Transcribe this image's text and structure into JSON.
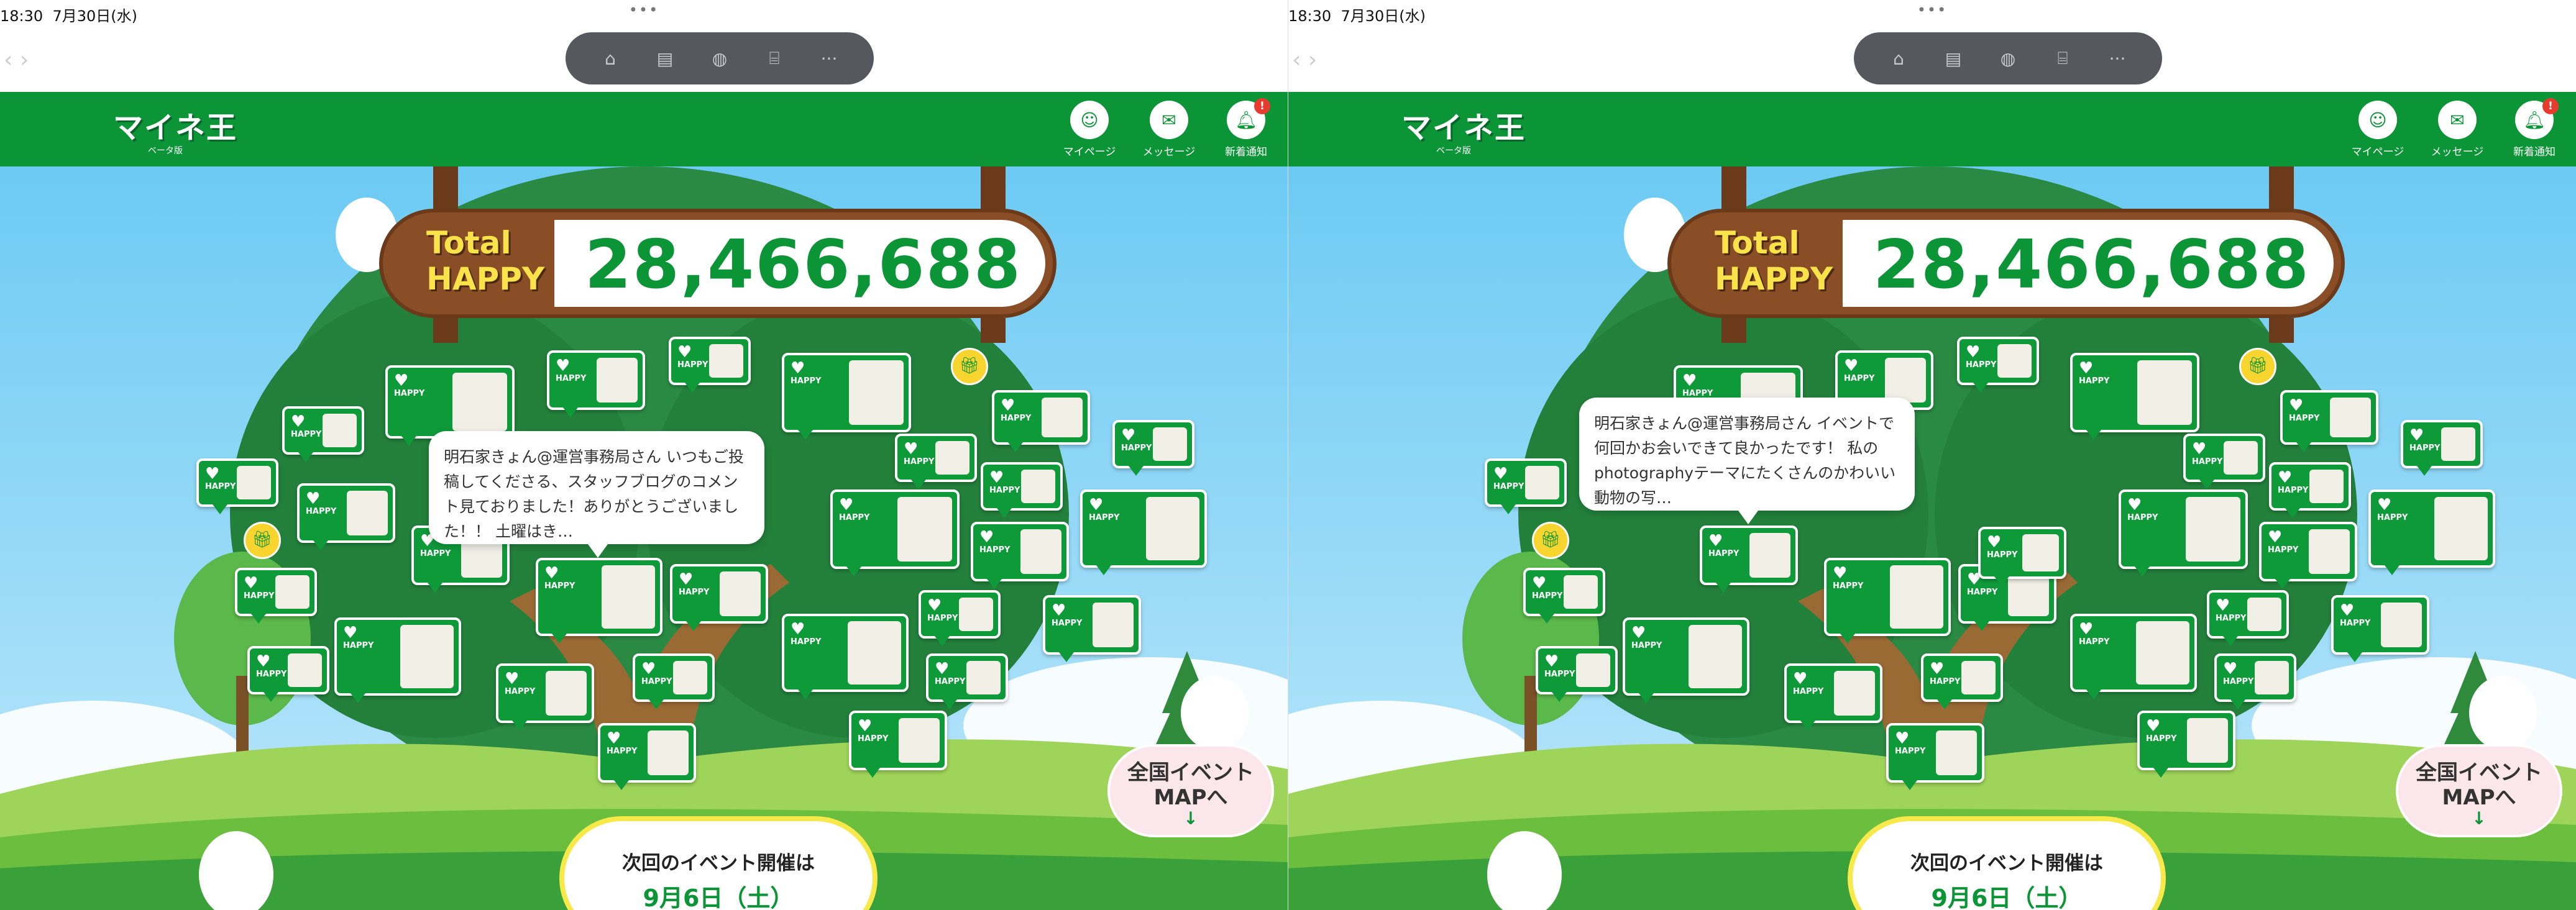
{
  "status": {
    "time": "18:30",
    "date": "7月30日(水)",
    "dots": "•••"
  },
  "toolbar": {
    "icons": [
      "home-icon",
      "book-icon",
      "chat-icon",
      "gift-icon",
      "more-icon"
    ]
  },
  "header": {
    "logo": "マイネ王",
    "beta": "ベータ版",
    "mypage": "マイページ",
    "message": "メッセージ",
    "notify": "新着通知",
    "notify_badge": "!"
  },
  "total": {
    "label_line1": "Total",
    "label_line2": "HAPPY",
    "value": "28,466,688"
  },
  "bubble_label": "HAPPY",
  "tooltips": {
    "left": "明石家きょん@運営事務局さん いつもご投稿してくださる、スタッフブログのコメント見ておりました！ありがとうございました！！ 土曜はき…",
    "right": "明石家きょん@運営事務局さん イベントで何回かお会いできて良かったです！ 私のphotographyテーマにたくさんのかわいい動物の写…"
  },
  "event_map": {
    "line1": "全国イベント",
    "line2": "MAPへ",
    "arrow": "↓"
  },
  "next_event": {
    "line1": "次回のイベント開催は",
    "line2": "9月6日（土）",
    "arrow": "↓"
  },
  "colors": {
    "header_green": "#0b9537",
    "sky": "#7fd1f6",
    "tree": "#1f7a3a",
    "board_brown": "#8a4e27"
  }
}
